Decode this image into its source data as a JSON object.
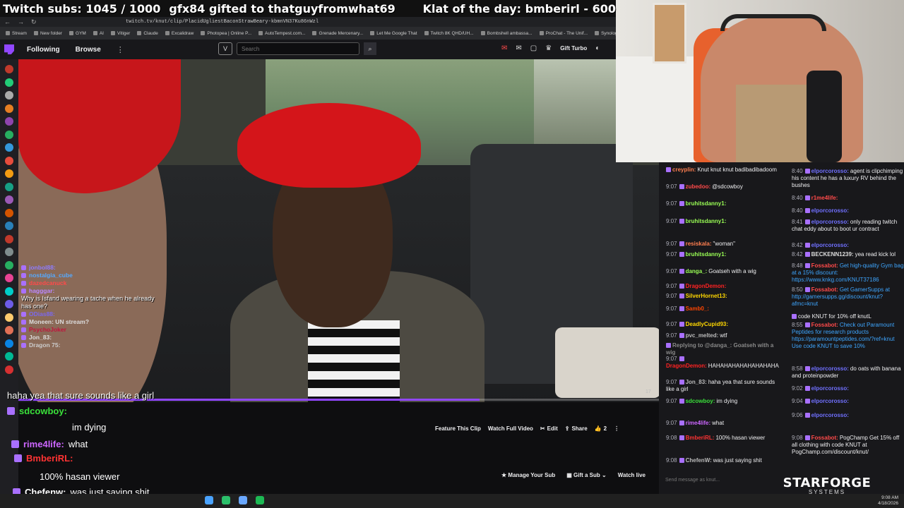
{
  "overlay": {
    "subs": "Twitch subs: 1045 / 1000",
    "gifted": "gfx84 gifted to thatguyfromwhat69",
    "klat": "Klat of the day: bmberirl - 600"
  },
  "browser": {
    "url": "twitch.tv/knut/clip/PlacidUgliestBaconStrawBeary-kbmnVN37Ku86nWzl",
    "bookmarks": [
      "Stream",
      "New folder",
      "GYM",
      "AI",
      "Vitiger",
      "Claude",
      "Excalidraw",
      "Photopea | Online P...",
      "AutoTempest.com...",
      "Grenade Mercenary...",
      "Let Me Google That",
      "Twitch 8K QHD/UH...",
      "Bombshell ambassa...",
      "ProChat - The Unif...",
      "Synology"
    ]
  },
  "twitch_nav": {
    "following": "Following",
    "browse": "Browse",
    "more_icon": "ellipsis-vertical-icon",
    "search_placeholder": "Search",
    "gift_turbo": "Gift Turbo",
    "notification_count": "1"
  },
  "video": {
    "progress_fraction": 0.72,
    "timer": "17",
    "caption": "haha yea that sure sounds like a girl"
  },
  "overlay_chat": [
    {
      "name": "jonbol88:",
      "color": "#8e7cff"
    },
    {
      "name": "nostalgia_cube",
      "color": "#55aaff"
    },
    {
      "name": "dazedcanuck",
      "color": "#ff4a4a"
    },
    {
      "name": "hagggar:",
      "color": "#bb88ff"
    },
    {
      "message": "Why is Isfand wearing a tache when he already has one?"
    },
    {
      "name": "ODias88:",
      "color": "#7b68ee"
    },
    {
      "name": "Moneen: UN stream?",
      "color": "#dddddd"
    },
    {
      "name": "PsychoJoker",
      "color": "#c0143c"
    },
    {
      "name": "Jon_83: ",
      "color": "#dddddd"
    },
    {
      "name": "Dragon 75:",
      "color": "#cccccc"
    }
  ],
  "bottom_chat": [
    {
      "name": "sdcowboy:",
      "color": "#3ae03a",
      "message": ""
    },
    {
      "name": "",
      "color": "#ffffff",
      "message": "im dying"
    },
    {
      "name": "rime4life:",
      "color": "#cc66ff",
      "message": "what"
    },
    {
      "name": "BmberiRL:",
      "color": "#ff3333",
      "message": ""
    },
    {
      "name": "",
      "color": "#ffffff",
      "message": "100% hasan viewer"
    },
    {
      "name": "Chefenw:",
      "color": "#ffffff",
      "message": "was just saying shit"
    }
  ],
  "clip_actions": {
    "feature": "Feature This Clip",
    "watch_full": "Watch Full Video",
    "edit": "Edit",
    "share": "Share",
    "likes": "2"
  },
  "sub_actions": {
    "manage": "Manage Your Sub",
    "gift": "Gift a Sub",
    "watch_live": "Watch live"
  },
  "chat_left": [
    {
      "time": "",
      "name": "creyplin:",
      "color": "#ff7f50",
      "msg": "Knut knut knut badibadibadoom"
    },
    {
      "time": "9:07",
      "name": "zubedoo:",
      "color": "#ff4a4a",
      "msg": "@sdcowboy"
    },
    {
      "time": "9:07",
      "name": "bruhitsdanny1:",
      "color": "#9aff55",
      "msg": ""
    },
    {
      "time": "9:07",
      "name": "bruhitsdanny1:",
      "color": "#9aff55",
      "msg": ""
    },
    {
      "time": "9:07",
      "name": "resiskala:",
      "color": "#ff7f50",
      "msg": "\"woman\""
    },
    {
      "time": "9:07",
      "name": "bruhitsdanny1:",
      "color": "#9aff55",
      "msg": ""
    },
    {
      "time": "9:07",
      "name": "danga_:",
      "color": "#9aff55",
      "msg": "Goatseh with a wig"
    },
    {
      "time": "9:07",
      "name": "DragonDemon:",
      "color": "#ff2222",
      "msg": ""
    },
    {
      "time": "9:07",
      "name": "SilverHornet13:",
      "color": "#ffd700",
      "msg": ""
    },
    {
      "time": "9:07",
      "name": "Samb0_:",
      "color": "#ff4500",
      "msg": ""
    },
    {
      "time": "9:07",
      "name": "DeadlyCupid93:",
      "color": "#ffd700",
      "msg": ""
    },
    {
      "time": "9:07",
      "name": "pvc_melted:",
      "color": "#bbbbbb",
      "msg": "wtf"
    },
    {
      "time": "",
      "name": "Replying to @danga_: Goatseh with a wig",
      "color": "#888888",
      "msg": ""
    },
    {
      "time": "9:07",
      "name": "DragonDemon:",
      "color": "#ff2222",
      "msg": "HAHAHAHAHAHAHAHAHA"
    },
    {
      "time": "9:07",
      "name": "Jon_83:",
      "color": "#bbbbbb",
      "msg": "haha yea that sure sounds like a girl"
    },
    {
      "time": "9:07",
      "name": "sdcowboy:",
      "color": "#3ae03a",
      "msg": "im dying"
    },
    {
      "time": "9:07",
      "name": "rime4life:",
      "color": "#cc66ff",
      "msg": "what"
    },
    {
      "time": "9:08",
      "name": "BmberiRL:",
      "color": "#ff3333",
      "msg": "100% hasan viewer"
    },
    {
      "time": "9:08",
      "name": "ChefenW:",
      "color": "#bbbbbb",
      "msg": "was just saying shit"
    }
  ],
  "chat_right": [
    {
      "time": "8:40",
      "name": "elporcorosso:",
      "color": "#7070ff",
      "msg": "agent is clipchimping his content he has a luxury RV behind the bushes"
    },
    {
      "time": "8:40",
      "name": "r1me4life:",
      "color": "#ff4a4a",
      "msg": ""
    },
    {
      "time": "8:40",
      "name": "elporcorosso:",
      "color": "#7070ff",
      "msg": ""
    },
    {
      "time": "8:41",
      "name": "elporcorosso:",
      "color": "#7070ff",
      "msg": "only reading twitch chat eddy about to boot ur contract"
    },
    {
      "time": "8:42",
      "name": "elporcorosso:",
      "color": "#7070ff",
      "msg": ""
    },
    {
      "time": "8:42",
      "name": "BECKENN1239:",
      "color": "#dddddd",
      "msg": "yea read kick lol"
    },
    {
      "time": "8:48",
      "name": "Fossabot:",
      "color": "#ff4a4a",
      "msg": "Get high-quality Gym bag at a 15% discount: https://www.knkg.com/KNUT37186"
    },
    {
      "time": "8:50",
      "name": "Fossabot:",
      "color": "#ff4a4a",
      "msg": "Get GamerSupps at http://gamersupps.gg/discount/knut?afmc=knut"
    },
    {
      "time": "",
      "name": "",
      "color": "#dddddd",
      "msg": "code KNUT for 10% off knutL"
    },
    {
      "time": "8:55",
      "name": "Fossabot:",
      "color": "#ff4a4a",
      "msg": "Check out Paramount Peptides for research products https://paramountpeptides.com/?ref=knut Use code KNUT to save 10%"
    },
    {
      "time": "8:58",
      "name": "elporcorosso:",
      "color": "#7070ff",
      "msg": "do oats with banana and proteinpowder"
    },
    {
      "time": "9:02",
      "name": "elporcorosso:",
      "color": "#7070ff",
      "msg": ""
    },
    {
      "time": "9:04",
      "name": "elporcorosso:",
      "color": "#7070ff",
      "msg": ""
    },
    {
      "time": "9:06",
      "name": "elporcorosso:",
      "color": "#7070ff",
      "msg": ""
    },
    {
      "time": "9:08",
      "name": "Fossabot:",
      "color": "#ff4a4a",
      "msg": "PogChamp Get 15% off all clothing with code KNUT at PogChamp.com/discount/knut/"
    }
  ],
  "chat_input_placeholder": "Send message as knut...",
  "logo": {
    "name": "STARFORGE",
    "sub": "SYSTEMS"
  },
  "clock": {
    "time": "9:08 AM",
    "date": "4/18/2026"
  },
  "colors": {
    "twitch_purple": "#9147ff",
    "chat_bg": "#18181b",
    "page_bg": "#0e0e10"
  }
}
